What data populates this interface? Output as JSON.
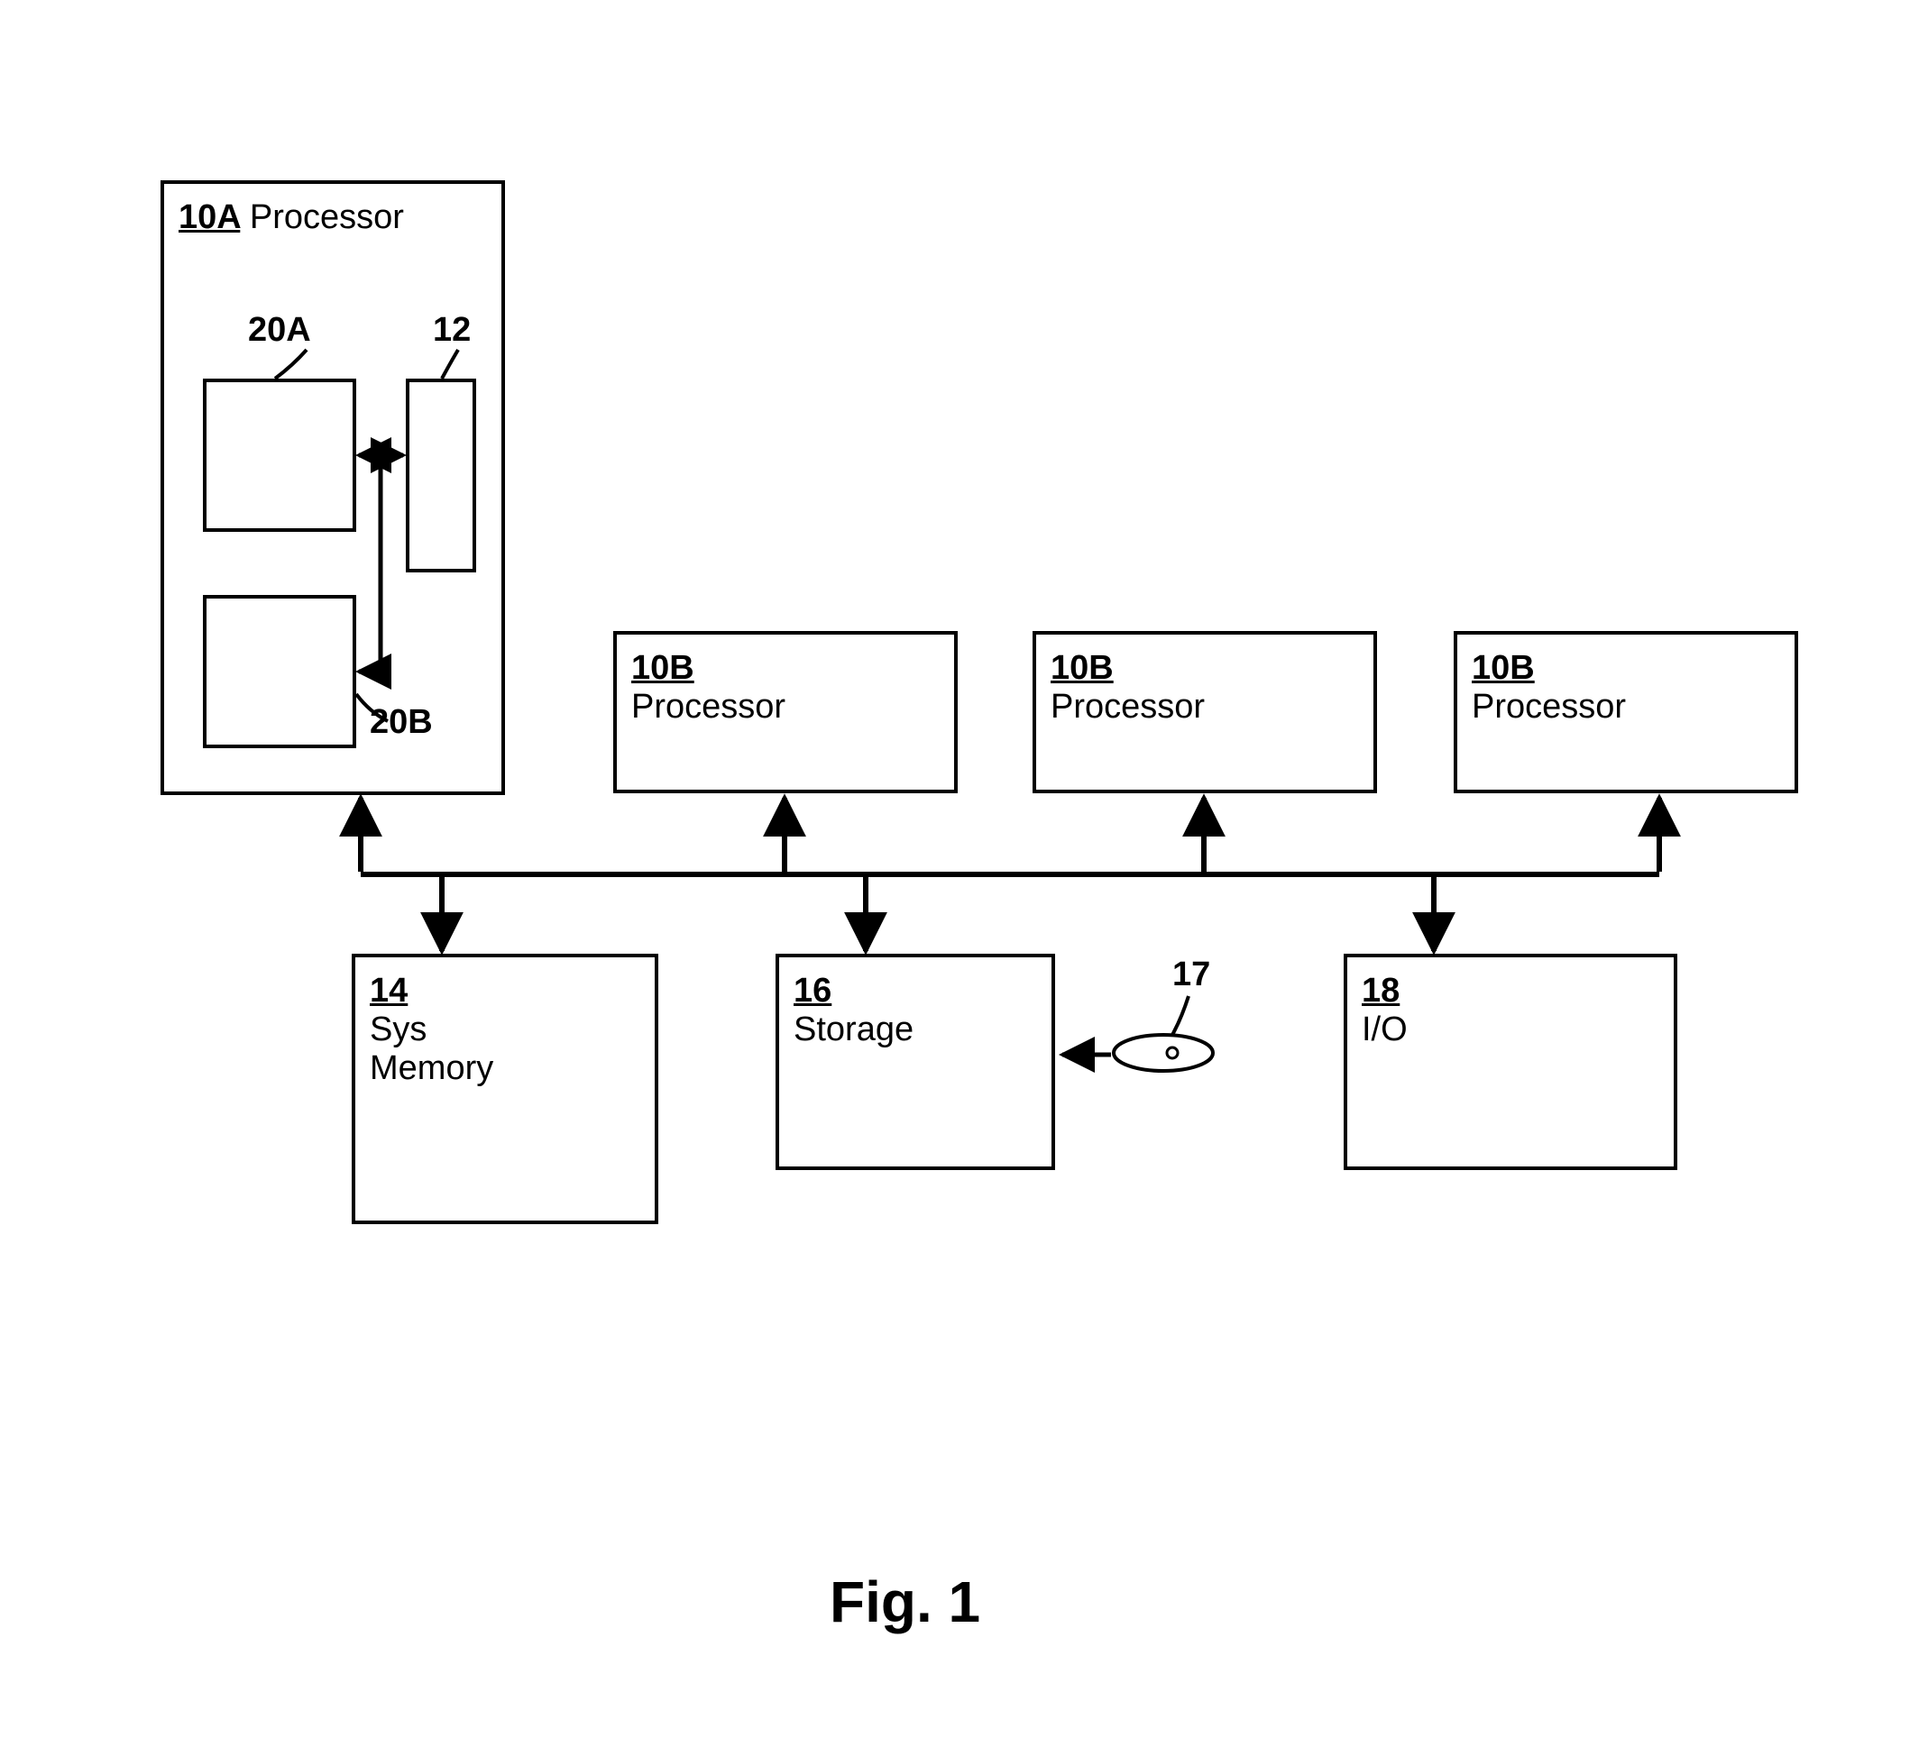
{
  "blocks": {
    "proc10A": {
      "ref": "10A",
      "text": "Processor"
    },
    "proc10B_1": {
      "ref": "10B",
      "text": "Processor"
    },
    "proc10B_2": {
      "ref": "10B",
      "text": "Processor"
    },
    "proc10B_3": {
      "ref": "10B",
      "text": "Processor"
    },
    "mem14": {
      "ref": "14",
      "line2": "Sys",
      "line3": "Memory"
    },
    "storage16": {
      "ref": "16",
      "text": "Storage"
    },
    "io18": {
      "ref": "18",
      "text": "I/O"
    }
  },
  "callouts": {
    "c20A": "20A",
    "c12": "12",
    "c20B": "20B",
    "c17": "17"
  },
  "figure": "Fig. 1"
}
